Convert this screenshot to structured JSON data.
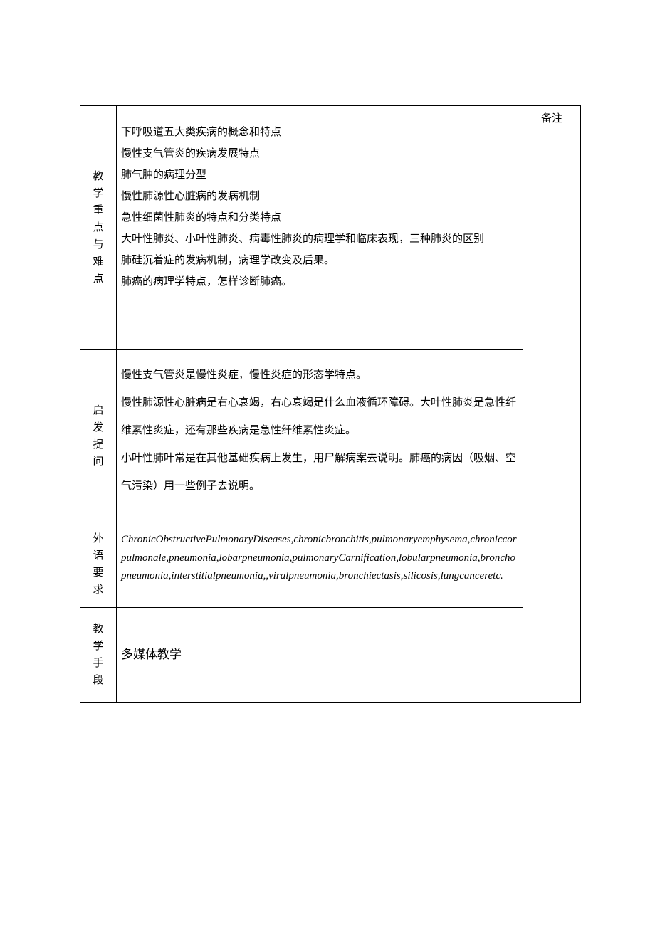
{
  "notes_header": "备注",
  "rows": [
    {
      "label": "教学重点与难点",
      "content": "下呼吸道五大类疾病的概念和特点\n慢性支气管炎的疾病发展特点\n肺气肿的病理分型\n慢性肺源性心脏病的发病机制\n急性细菌性肺炎的特点和分类特点\n大叶性肺炎、小叶性肺炎、病毒性肺炎的病理学和临床表现，三种肺炎的区别\n肺硅沉着症的发病机制，病理学改变及后果。\n肺癌的病理学特点，怎样诊断肺癌。"
    },
    {
      "label": "启发提问",
      "content": "慢性支气管炎是慢性炎症，慢性炎症的形态学特点。\n慢性肺源性心脏病是右心衰竭，右心衰竭是什么血液循环障碍。大叶性肺炎是急性纤维素性炎症，还有那些疾病是急性纤维素性炎症。\n小叶性肺叶常是在其他基础疾病上发生，用尸解病案去说明。肺癌的病因（吸烟、空气污染）用一些例子去说明。"
    },
    {
      "label": "外语要求",
      "content": "ChronicObstructivePulmonaryDiseases,chronicbronchitis,pulmonaryemphysema,chroniccorpulmonale,pneumonia,lobarpneumonia,pulmonaryCarnification,lobularpneumonia,bronchopneumonia,interstitialpneumonia,,viralpneumonia,bronchiectasis,silicosis,lungcanceretc."
    },
    {
      "label": "教学手段",
      "content": "多媒体教学"
    }
  ]
}
